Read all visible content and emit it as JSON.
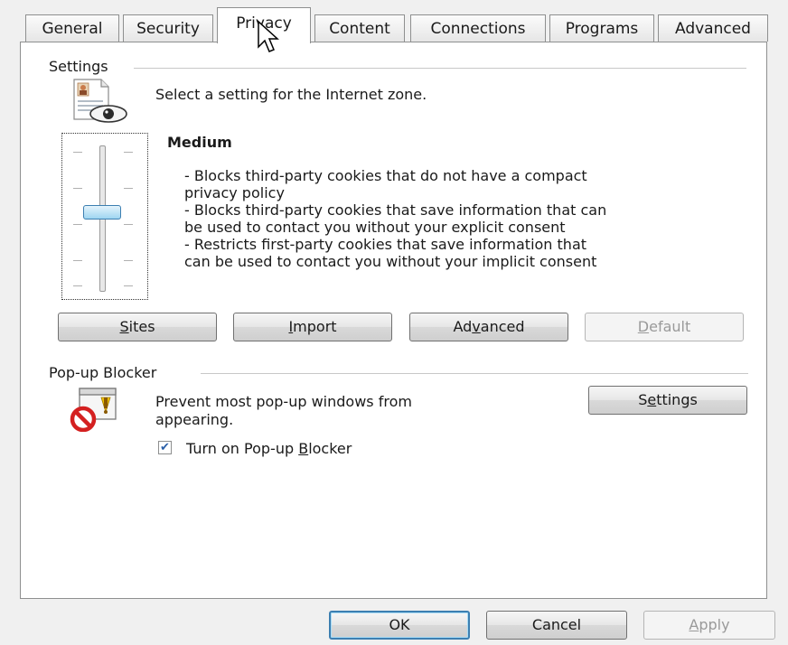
{
  "tabs": [
    {
      "label": "General"
    },
    {
      "label": "Security"
    },
    {
      "label": "Privacy",
      "active": true
    },
    {
      "label": "Content"
    },
    {
      "label": "Connections"
    },
    {
      "label": "Programs"
    },
    {
      "label": "Advanced"
    }
  ],
  "settings": {
    "group_label": "Settings",
    "zone_text": "Select a setting for the Internet zone.",
    "level_title": "Medium",
    "level_level": 0.5,
    "description_lines": [
      "- Blocks third-party cookies that do not have a compact",
      "privacy policy",
      "- Blocks third-party cookies that save information that can",
      "be used to contact you without your explicit consent",
      "- Restricts first-party cookies that save information that",
      "can be used to contact you without your implicit consent"
    ],
    "buttons": {
      "sites": {
        "before": "",
        "key": "S",
        "after": "ites"
      },
      "import": {
        "before": "",
        "key": "I",
        "after": "mport"
      },
      "advanced": {
        "before": "Ad",
        "key": "v",
        "after": "anced"
      },
      "default": {
        "before": "",
        "key": "D",
        "after": "efault",
        "disabled": true
      }
    }
  },
  "popup": {
    "group_label": "Pop-up Blocker",
    "text_line1": "Prevent most pop-up windows from",
    "text_line2": "appearing.",
    "settings_button": {
      "before": "S",
      "key": "e",
      "after": "ttings"
    },
    "checkbox": {
      "checked": true,
      "before": "Turn on Pop-up ",
      "key": "B",
      "after": "locker"
    }
  },
  "footer": {
    "ok": "OK",
    "cancel": "Cancel",
    "apply": {
      "before": "",
      "key": "A",
      "after": "pply",
      "disabled": true
    }
  },
  "colors": {
    "accent": "#3c7fb1",
    "panel": "#ffffff",
    "chrome": "#f0f0f0"
  }
}
